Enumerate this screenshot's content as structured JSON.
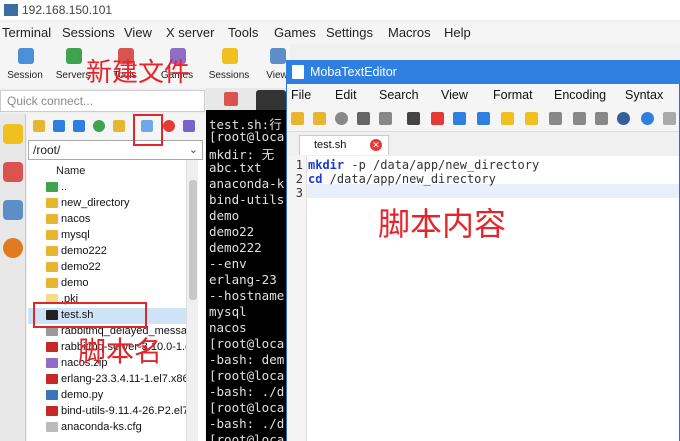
{
  "window": {
    "title": "192.168.150.101"
  },
  "menubar": [
    "Terminal",
    "Sessions",
    "View",
    "X server",
    "Tools",
    "Games",
    "Settings",
    "Macros",
    "Help"
  ],
  "toolbar": [
    "Session",
    "Servers",
    "Tools",
    "Games",
    "Sessions",
    "View"
  ],
  "quick_connect": {
    "placeholder": "Quick connect..."
  },
  "file_browser": {
    "path": "/root/",
    "column_name": "Name",
    "items": [
      "..",
      "new_directory",
      "nacos",
      "mysql",
      "demo222",
      "demo22",
      "demo",
      ".pki",
      "test.sh",
      "rabbitmq_delayed_messag",
      "rabbitmq-server-3.10.0-1.e",
      "nacos.zip",
      "erlang-23.3.4.11-1.el7.x86_",
      "demo.py",
      "bind-utils-9.11.4-26.P2.el7.",
      "anaconda-ks.cfg"
    ]
  },
  "terminal": {
    "lines": [
      "test.sh:行",
      "[root@loca",
      "mkdir: 无",
      "abc.txt",
      "anaconda-k",
      "bind-utils",
      "demo",
      "demo22",
      "demo222",
      "--env",
      "erlang-23",
      "--hostname",
      "mysql",
      "nacos",
      "[root@loca",
      "-bash: dem",
      "[root@loca",
      "-bash: ./d",
      "[root@loca",
      "-bash: ./d",
      "[root@loca"
    ]
  },
  "editor": {
    "title": "MobaTextEditor",
    "menu": [
      "File",
      "Edit",
      "Search",
      "View",
      "Format",
      "Encoding",
      "Syntax"
    ],
    "tab": "test.sh",
    "lines": [
      {
        "num": "1",
        "kw": "mkdir",
        "rest": " -p /data/app/new_directory"
      },
      {
        "num": "2",
        "kw": "cd",
        "rest": " /data/app/new_directory"
      },
      {
        "num": "3",
        "kw": "",
        "rest": ""
      }
    ]
  },
  "annotations": {
    "new_file": "新建文件",
    "script_content": "脚本内容",
    "script_name": "脚本名"
  }
}
